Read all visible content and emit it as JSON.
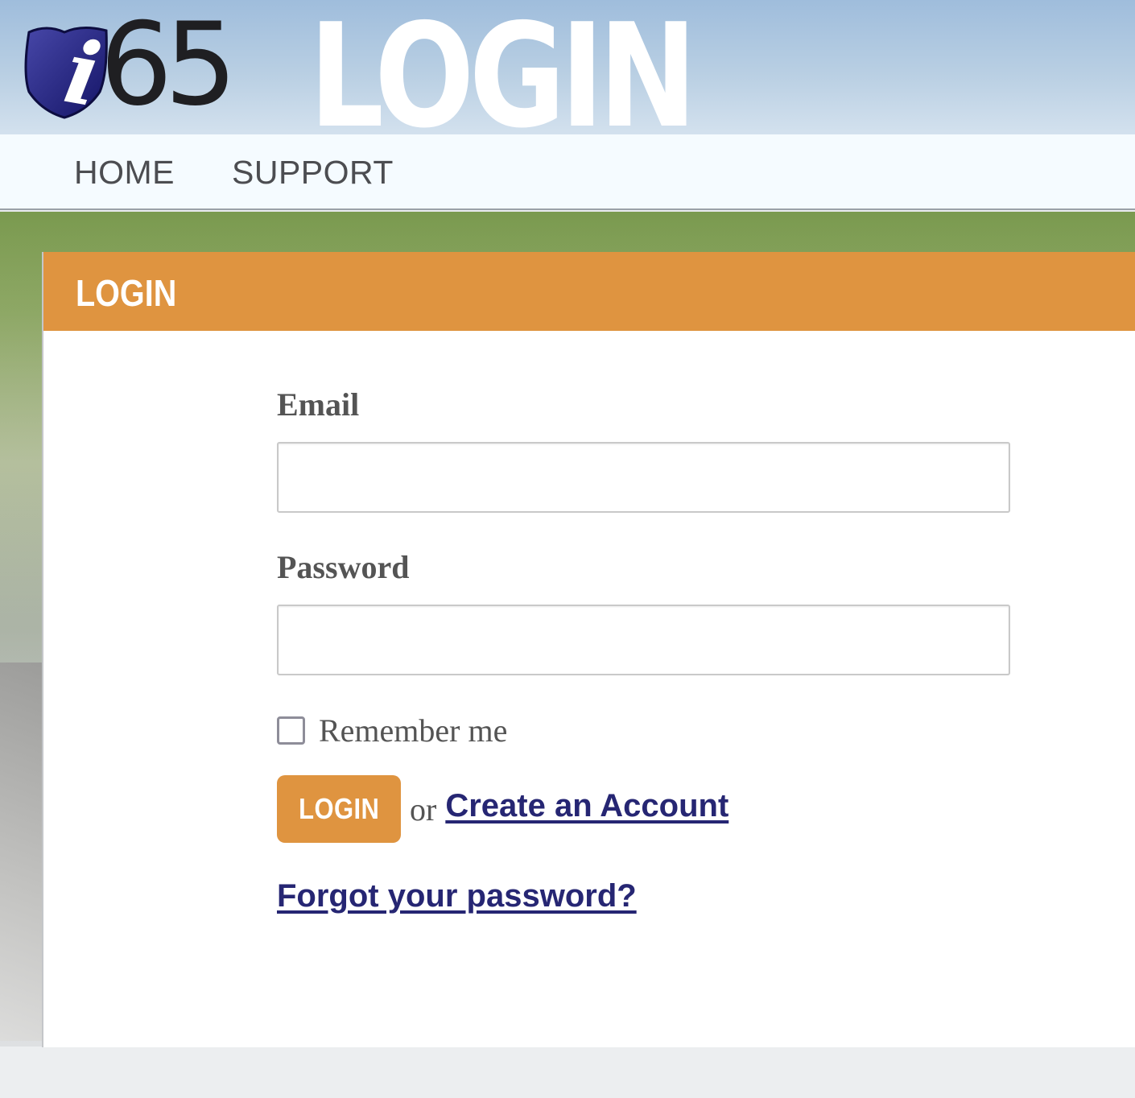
{
  "header": {
    "logo": {
      "prefix": "i",
      "number": "65",
      "shield_color": "#1f1f7a"
    },
    "hero_title": "LOGIN"
  },
  "nav": {
    "items": [
      {
        "label": "HOME"
      },
      {
        "label": "SUPPORT"
      }
    ]
  },
  "card": {
    "title": "LOGIN",
    "accent_color": "#df9440"
  },
  "form": {
    "email": {
      "label": "Email",
      "value": "",
      "placeholder": ""
    },
    "password": {
      "label": "Password",
      "value": "",
      "placeholder": ""
    },
    "remember": {
      "label": "Remember me",
      "checked": false
    },
    "submit_label": "LOGIN",
    "or_text": "or",
    "create_account_label": "Create an Account",
    "forgot_password_label": "Forgot your password?",
    "link_color": "#262673"
  }
}
